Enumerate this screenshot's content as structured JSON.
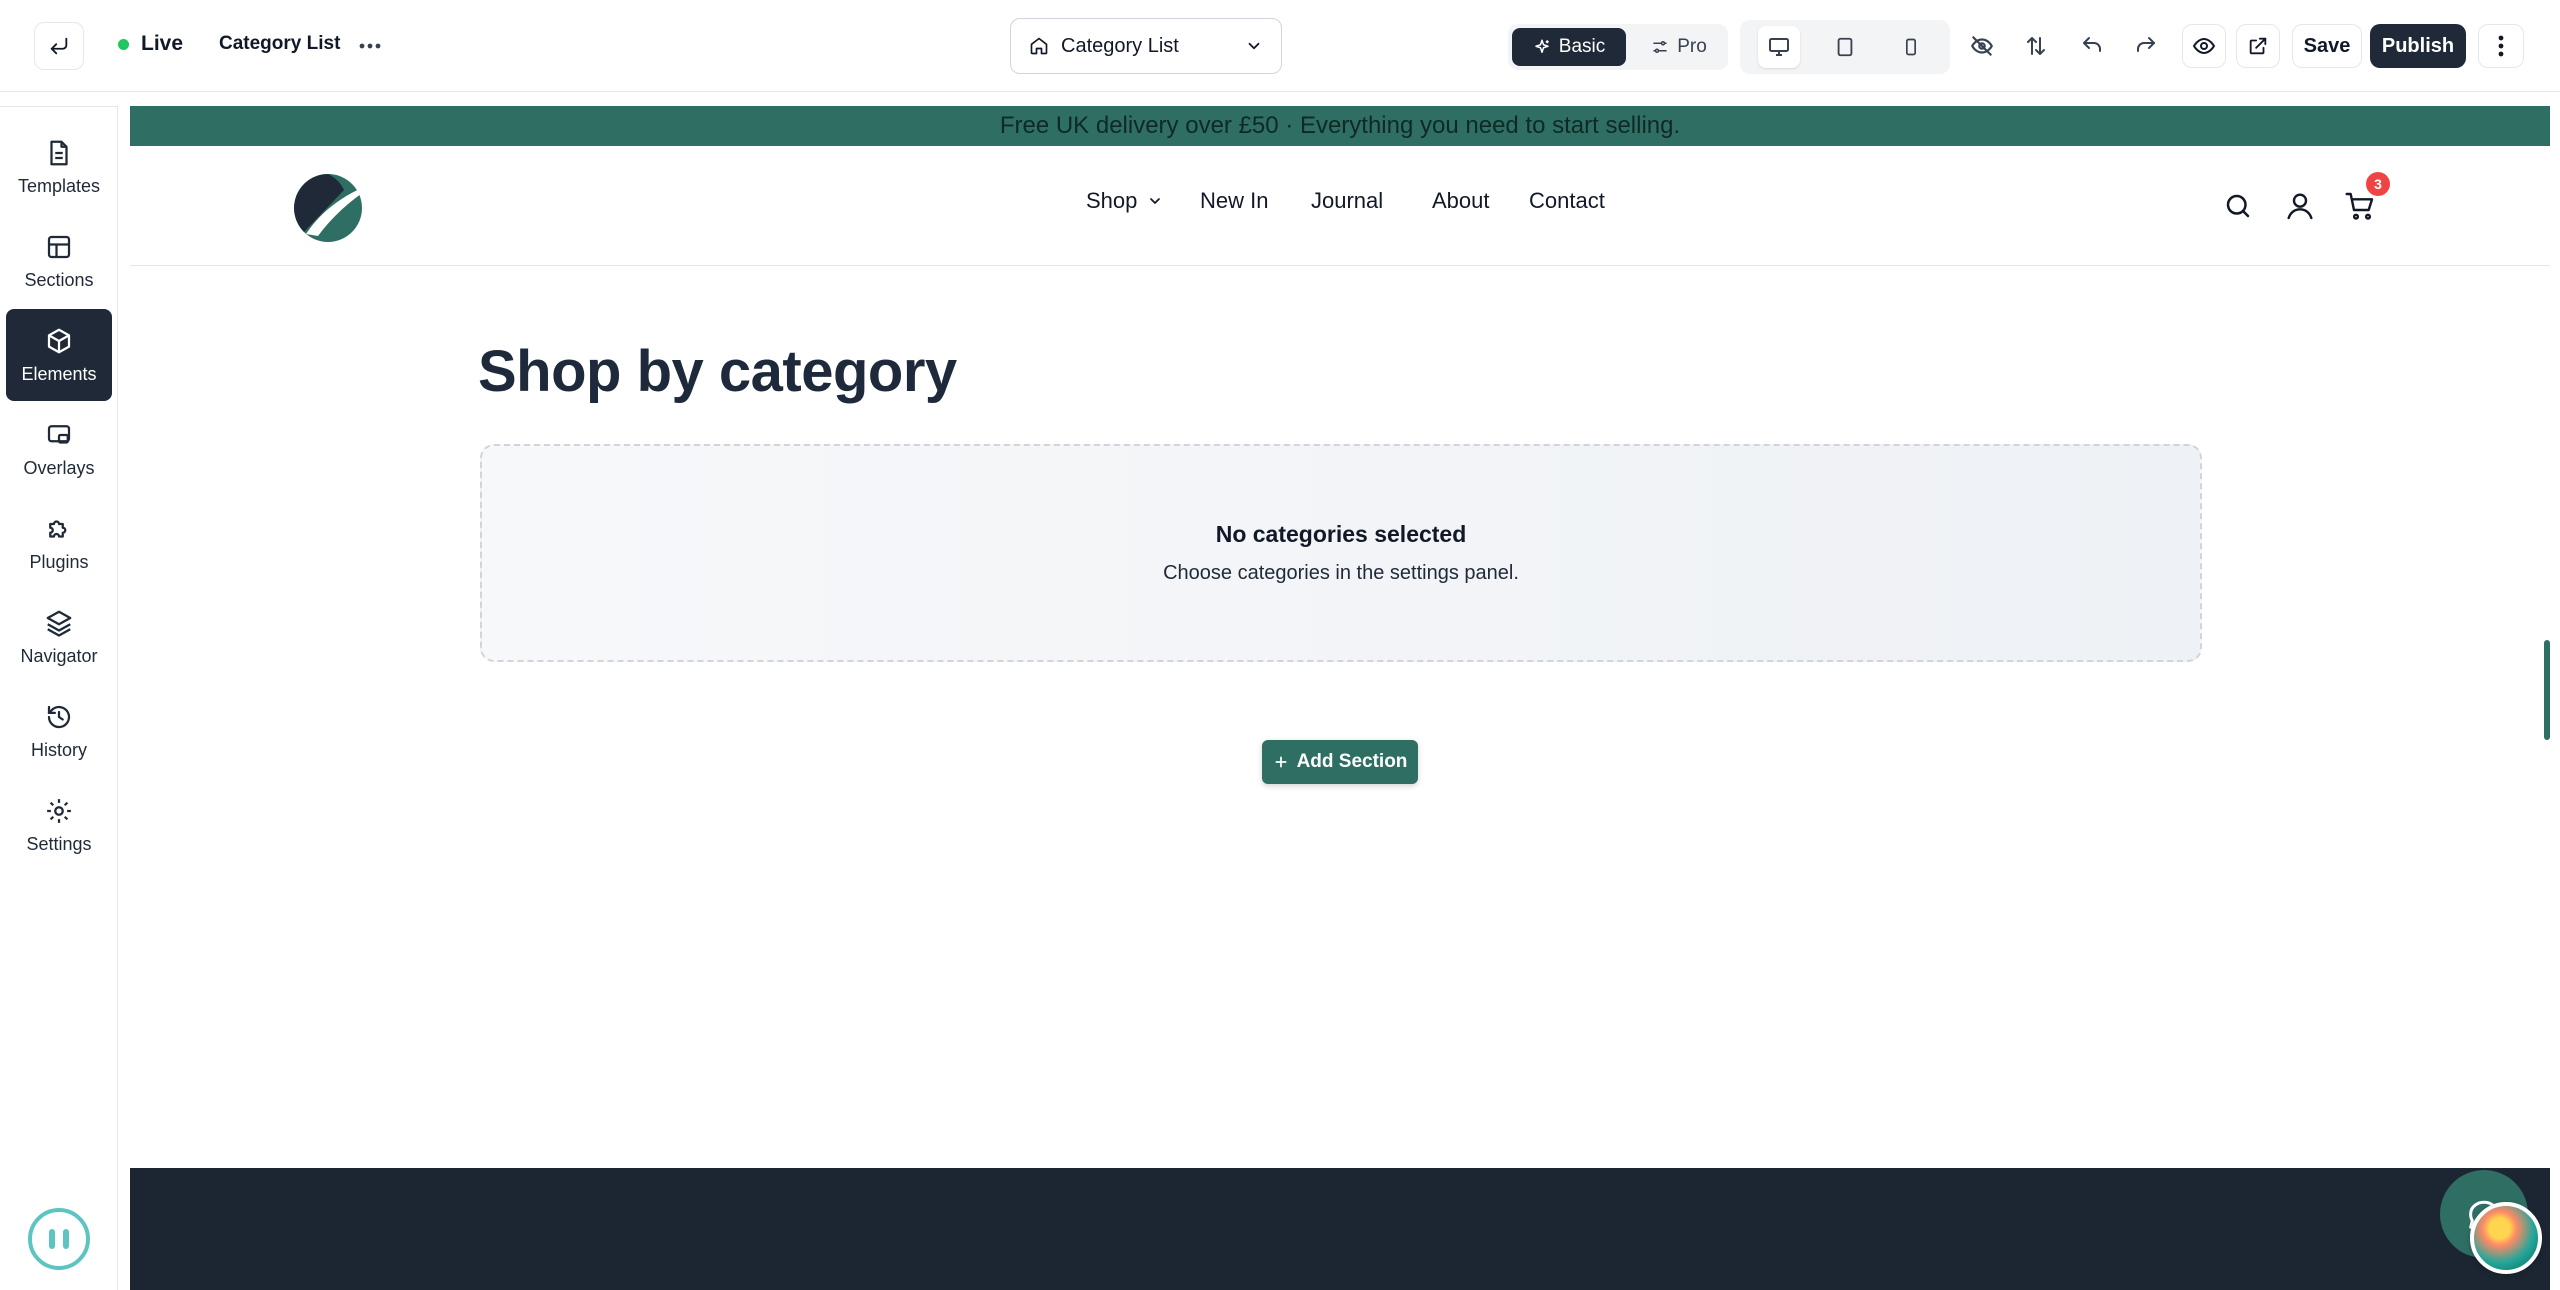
{
  "topbar": {
    "status_label": "Live",
    "page_name": "Category List",
    "page_select_label": "Category List",
    "mode_basic_label": "Basic",
    "mode_pro_label": "Pro",
    "save_label": "Save",
    "publish_label": "Publish"
  },
  "sidebar": {
    "items": [
      {
        "label": "Templates"
      },
      {
        "label": "Sections"
      },
      {
        "label": "Elements"
      },
      {
        "label": "Overlays"
      },
      {
        "label": "Plugins"
      },
      {
        "label": "Navigator"
      },
      {
        "label": "History"
      },
      {
        "label": "Settings"
      }
    ]
  },
  "site": {
    "announcement": "Free UK delivery over £50 · Everything you need to start selling.",
    "nav": {
      "shop": "Shop",
      "new_in": "New In",
      "journal": "Journal",
      "about": "About",
      "contact": "Contact"
    },
    "cart_count": "3",
    "section_title": "Shop by category",
    "empty_title": "No categories selected",
    "empty_subtitle": "Choose categories in the settings panel.",
    "add_section_label": "Add Section"
  },
  "colors": {
    "brand": "#2f6e62",
    "dark": "#1f2937",
    "footer": "#1c2633",
    "badge": "#ef4444",
    "live": "#22c55e"
  }
}
